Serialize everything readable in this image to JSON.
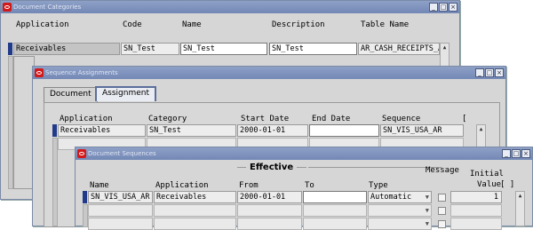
{
  "win1": {
    "title": "Document Categories",
    "headers": {
      "application": "Application",
      "code": "Code",
      "name": "Name",
      "description": "Description",
      "table_name": "Table Name"
    },
    "row": {
      "application": "Receivables",
      "code": "SN_Test",
      "name": "SN_Test",
      "description": "SN_Test",
      "table_name": "AR_CASH_RECEIPTS_AL"
    }
  },
  "win2": {
    "title": "Sequence Assignments",
    "tabs": [
      "Document",
      "Assignment"
    ],
    "headers": {
      "application": "Application",
      "category": "Category",
      "start_date": "Start Date",
      "end_date": "End Date",
      "sequence": "Sequence",
      "bracket": "["
    },
    "row": {
      "application": "Receivables",
      "category": "SN_Test",
      "start_date": "2000-01-01",
      "end_date": "",
      "sequence": "SN_VIS_USA_AR"
    }
  },
  "win3": {
    "title": "Document Sequences",
    "effective": "Effective",
    "headers": {
      "name": "Name",
      "application": "Application",
      "from": "From",
      "to": "To",
      "type": "Type",
      "message": "Message",
      "initial": "Initial",
      "value": "Value",
      "bracket": "[ ]"
    },
    "row": {
      "name": "SN_VIS_USA_AR",
      "application": "Receivables",
      "from": "2000-01-01",
      "to": "",
      "type": "Automatic",
      "message": "",
      "initial_value": "1"
    }
  },
  "window_controls": {
    "minimize": "_",
    "maximize": "□",
    "close": "×"
  },
  "icons": {
    "oracle": "oracle-icon",
    "scroll_up": "▲",
    "dropdown": "▼"
  }
}
